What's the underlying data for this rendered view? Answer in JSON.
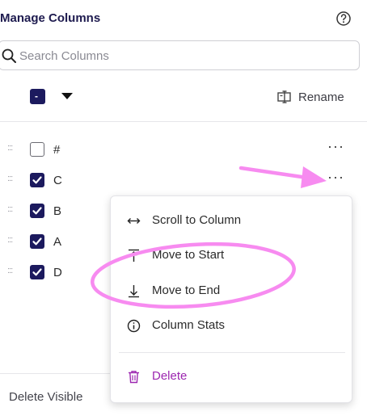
{
  "header": {
    "title": "Manage Columns",
    "help_icon": "question-circle-icon"
  },
  "search": {
    "placeholder": "Search Columns",
    "value": ""
  },
  "toolbar": {
    "bulk_check_symbol": "-",
    "rename_label": "Rename"
  },
  "columns": [
    {
      "label": "#",
      "checked": false
    },
    {
      "label": "C",
      "checked": true
    },
    {
      "label": "B",
      "checked": true
    },
    {
      "label": "A",
      "checked": true
    },
    {
      "label": "D",
      "checked": true
    }
  ],
  "row_more_symbol": "···",
  "footer": {
    "delete_visible_label": "Delete Visible"
  },
  "context_menu": {
    "items": [
      {
        "label": "Scroll to Column",
        "icon": "horizontal-arrows-icon"
      },
      {
        "label": "Move to Start",
        "icon": "arrow-up-to-bar-icon"
      },
      {
        "label": "Move to End",
        "icon": "arrow-down-to-bar-icon"
      },
      {
        "label": "Column Stats",
        "icon": "info-circle-icon"
      },
      {
        "label": "Delete",
        "icon": "trash-icon"
      }
    ]
  },
  "colors": {
    "brand_navy": "#1c1a5e",
    "delete_purple": "#9c27b0",
    "annotation_pink": "#f78bf0"
  }
}
